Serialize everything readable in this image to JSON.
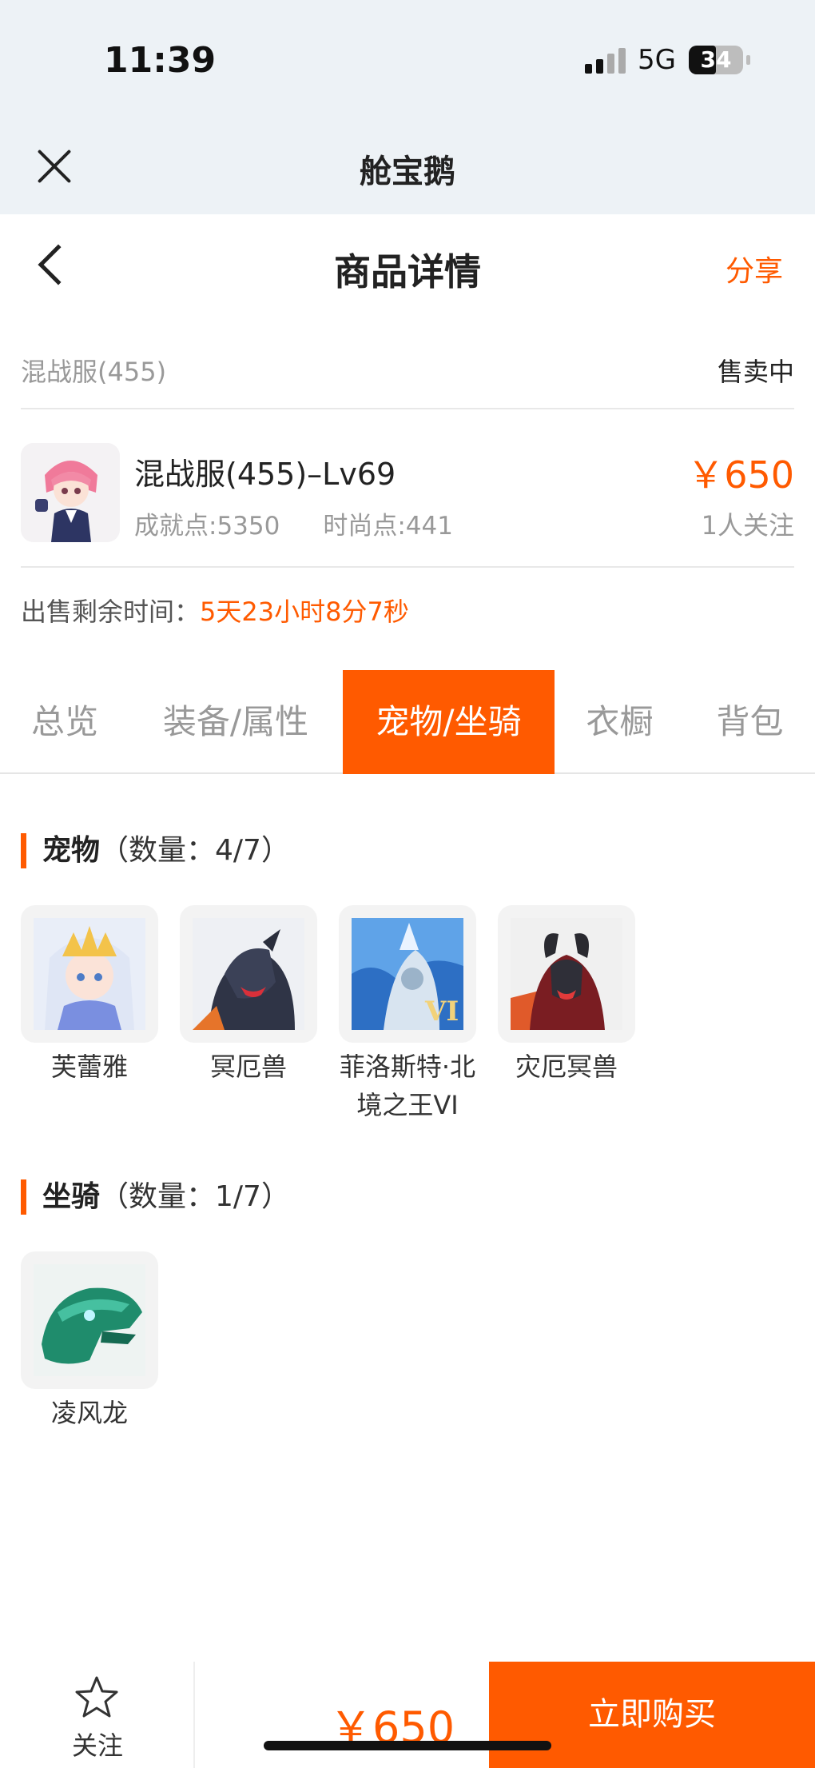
{
  "status_bar": {
    "time": "11:39",
    "network": "5G",
    "battery": "34"
  },
  "app_header": {
    "title": "舱宝鹅"
  },
  "nav": {
    "title": "商品详情",
    "share": "分享"
  },
  "listing": {
    "server": "混战服(455)",
    "status": "售卖中",
    "name": "混战服(455)–Lv69",
    "achievement": "成就点:5350",
    "fashion": "时尚点:441",
    "price": "￥650",
    "followers": "1人关注",
    "remaining_label": "出售剩余时间：",
    "remaining_value": "5天23小时8分7秒"
  },
  "tabs": [
    "总览",
    "装备/属性",
    "宠物/坐骑",
    "衣橱",
    "背包"
  ],
  "active_tab": "宠物/坐骑",
  "pets": {
    "title": "宠物",
    "count": "（数量：4/7）",
    "items": [
      "芙蕾雅",
      "冥厄兽",
      "菲洛斯特·北境之王VI",
      "灾厄冥兽"
    ]
  },
  "mounts": {
    "title": "坐骑",
    "count": "（数量：1/7）",
    "items": [
      "凌风龙"
    ]
  },
  "bottom": {
    "follow": "关注",
    "price": "￥650",
    "buy": "立即购买"
  },
  "colors": {
    "accent": "#ff5a00",
    "header_bg": "#edf2f6"
  },
  "icons": [
    "close-icon",
    "back-icon",
    "star-icon"
  ]
}
